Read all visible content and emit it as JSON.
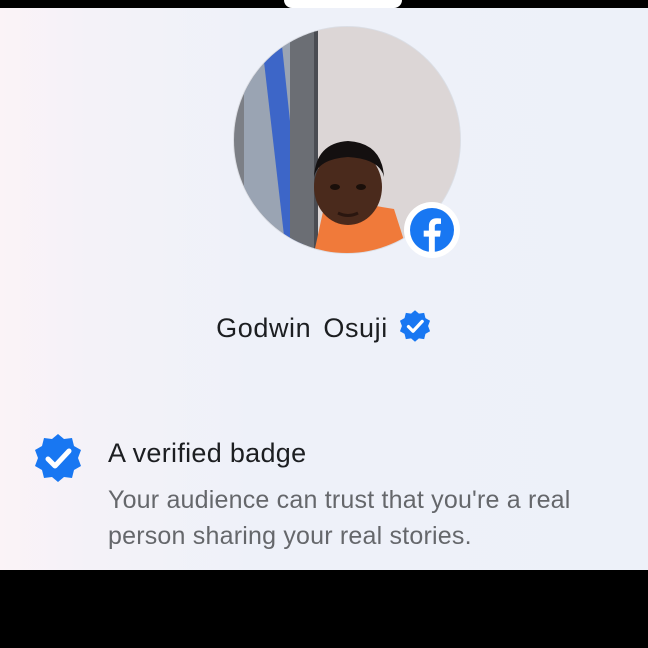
{
  "profile": {
    "name": "Godwin  Osuji",
    "verified": true
  },
  "feature": {
    "title": "A verified badge",
    "description_lines": [
      "Your audience can trust that you're a real",
      "person sharing your real stories."
    ]
  },
  "icons": {
    "platform_badge": "facebook-logo-icon",
    "name_badge": "verified-badge-icon",
    "feature_icon": "verified-badge-icon"
  },
  "colors": {
    "accent": "#1877f2",
    "text_primary": "#1c1e21",
    "text_secondary": "#65676b"
  }
}
